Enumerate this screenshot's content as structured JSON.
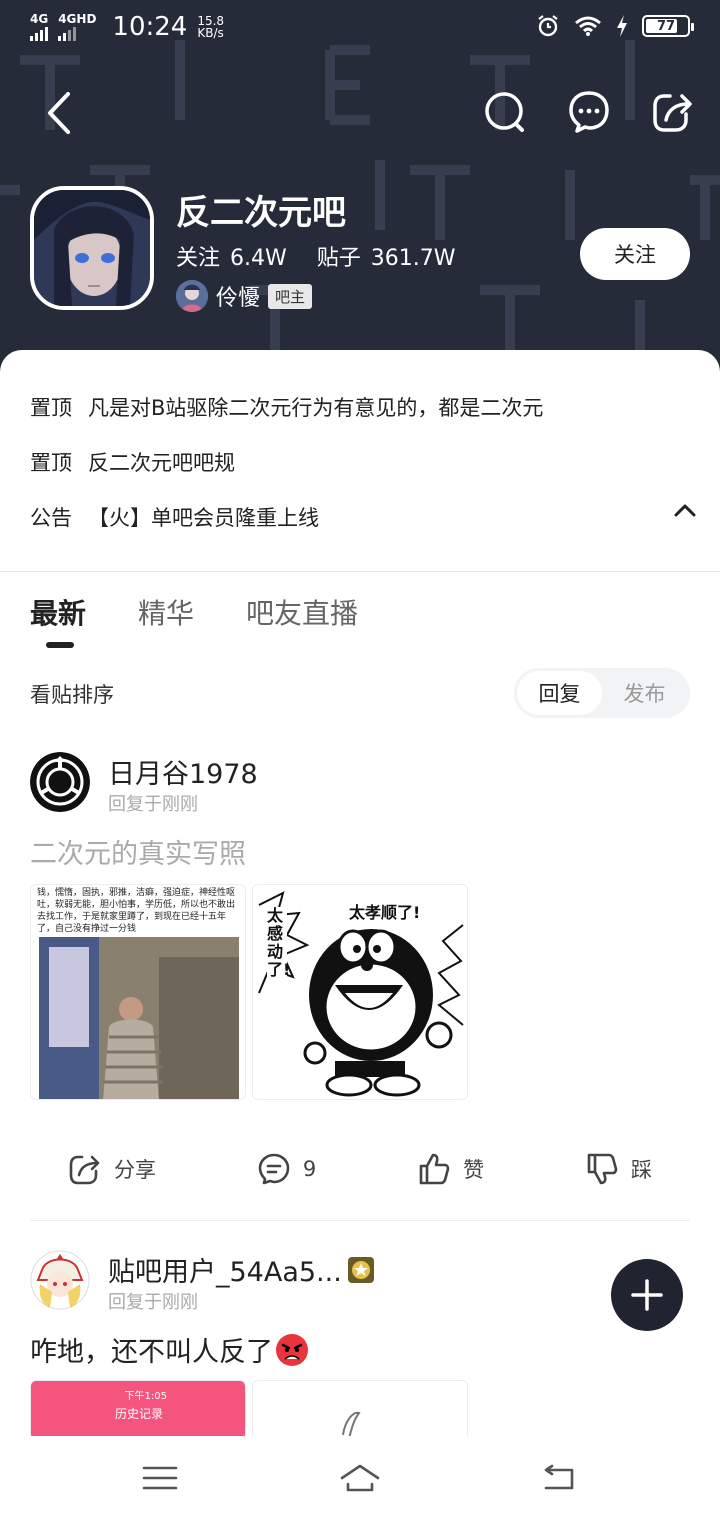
{
  "status_bar": {
    "signal1": "4G",
    "signal2": "4GHD",
    "time": "10:24",
    "speed_value": "15.8",
    "speed_unit": "KB/s",
    "battery": "77",
    "battery_level": 0.77,
    "icons": [
      "alarm-icon",
      "wifi-icon",
      "charging-icon",
      "battery-icon"
    ]
  },
  "header": {
    "bar_name": "反二次元吧",
    "follow_label": "关注",
    "follow_value": "6.4W",
    "posts_label": "贴子",
    "posts_value": "361.7W",
    "owner_name": "伶懮",
    "owner_badge": "吧主",
    "follow_button": "关注",
    "icons": [
      "back-icon",
      "search-icon",
      "more-icon",
      "share-icon"
    ]
  },
  "notices": [
    {
      "tag": "置顶",
      "text": "凡是对B站驱除二次元行为有意见的，都是二次元"
    },
    {
      "tag": "置顶",
      "text": "反二次元吧吧规"
    },
    {
      "tag": "公告",
      "text": "【火】单吧会员隆重上线"
    }
  ],
  "tabs": [
    "最新",
    "精华",
    "吧友直播"
  ],
  "sort": {
    "label": "看贴排序",
    "options": [
      "回复",
      "发布"
    ],
    "selected": "回复"
  },
  "posts": [
    {
      "user": "日月谷1978",
      "time": "回复于刚刚",
      "text": "二次元的真实写照",
      "image1_text": "钱，懦惰，固执，邪推，洁癖，强迫症，神经性呕吐，软弱无能，胆小怕事，学历低，所以也不敢出去找工作，于是就家里蹲了，到现在已经十五年了，自己没有挣过一分钱",
      "image2_text_a": "太孝顺了!",
      "image2_text_b": "太感动了!",
      "actions": {
        "share": "分享",
        "comment": "9",
        "like": "赞",
        "dislike": "踩"
      }
    },
    {
      "user": "贴吧用户_54Aa5...",
      "time": "回复于刚刚",
      "text": "咋地，还不叫人反了",
      "image1_time": "下午1:05",
      "image1_title": "历史记录"
    }
  ],
  "colors": {
    "header_bg": "#262b3a",
    "fab_bg": "#1f2430",
    "text_main": "#222222",
    "text_sub": "#aaaaaa"
  }
}
